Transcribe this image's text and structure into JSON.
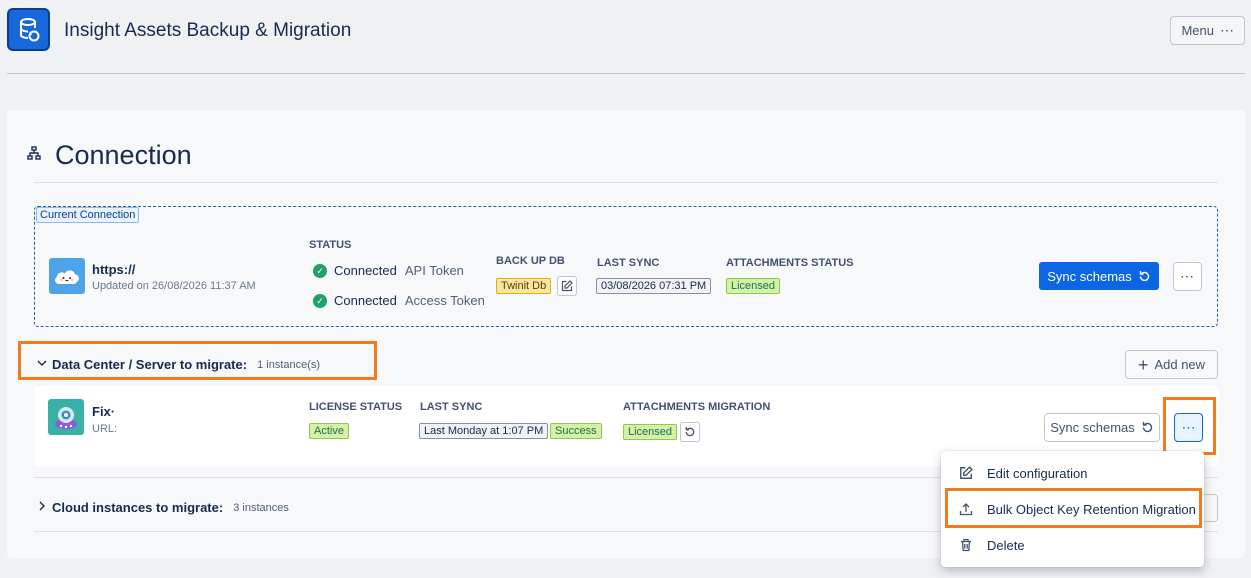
{
  "app": {
    "title": "Insight Assets Backup & Migration",
    "menu_label": "Menu"
  },
  "page": {
    "title": "Connection"
  },
  "current_connection": {
    "tag": "Current Connection",
    "url": "https://",
    "updated": "Updated on 26/08/2026 11:37 AM",
    "status_label": "STATUS",
    "status": [
      {
        "state": "Connected",
        "type": "API Token"
      },
      {
        "state": "Connected",
        "type": "Access Token"
      }
    ],
    "backup_db_label": "BACK UP DB",
    "backup_db_value": "Twinit Db",
    "last_sync_label": "LAST SYNC",
    "last_sync_value": "03/08/2026 07:31 PM",
    "attachments_status_label": "ATTACHMENTS STATUS",
    "attachments_status_value": "Licensed",
    "sync_button": "Sync schemas"
  },
  "dc_section": {
    "title": "Data Center / Server to migrate:",
    "count": "1 instance(s)",
    "add_new": "Add new",
    "instance": {
      "name": "Fix·",
      "url_label": "URL:",
      "license_status_label": "LICENSE STATUS",
      "license_status_value": "Active",
      "last_sync_label": "LAST SYNC",
      "last_sync_value": "Last Monday at 1:07 PM",
      "last_sync_result": "Success",
      "attachments_migration_label": "ATTACHMENTS MIGRATION",
      "attachments_migration_value": "Licensed",
      "sync_button": "Sync schemas"
    }
  },
  "cloud_section": {
    "title": "Cloud instances to migrate:",
    "count": "3 instances"
  },
  "dropdown": {
    "items": [
      {
        "label": "Edit configuration",
        "icon": "edit-icon"
      },
      {
        "label": "Bulk Object Key Retention Migration",
        "icon": "upload-icon"
      },
      {
        "label": "Delete",
        "icon": "trash-icon"
      }
    ]
  },
  "colors": {
    "primary": "#0c66e4",
    "highlight": "#f27b20",
    "success": "#22a06b"
  }
}
